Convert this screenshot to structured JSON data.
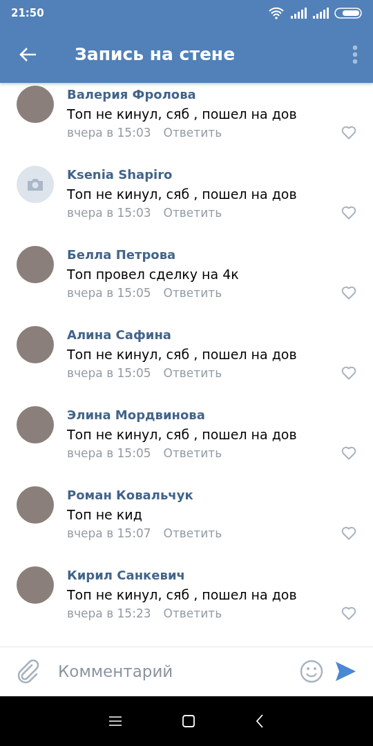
{
  "status_bar": {
    "time": "21:50"
  },
  "toolbar": {
    "title": "Запись на стене"
  },
  "comments": [
    {
      "kind": "photo",
      "author": "Валерия Фролова",
      "text": "Топ не кинул, сяб , пошел на дов",
      "time": "вчера в 15:03",
      "reply": "Ответить"
    },
    {
      "kind": "no_photo",
      "author": "Ksenia Shapiro",
      "text": "Топ не кинул, сяб , пошел на дов",
      "time": "вчера в 15:03",
      "reply": "Ответить"
    },
    {
      "kind": "photo",
      "author": "Белла Петрова",
      "text": "Топ провел сделку на 4к",
      "time": "вчера в 15:05",
      "reply": "Ответить"
    },
    {
      "kind": "photo",
      "author": "Алина Сафина",
      "text": "Топ не кинул, сяб , пошел на дов",
      "time": "вчера в 15:05",
      "reply": "Ответить"
    },
    {
      "kind": "photo",
      "author": "Элина Мордвинова",
      "text": "Топ не кинул, сяб , пошел на дов",
      "time": "вчера в 15:05",
      "reply": "Ответить"
    },
    {
      "kind": "photo",
      "author": "Роман Ковальчук",
      "text": "Топ не кид",
      "time": "вчера в 15:07",
      "reply": "Ответить"
    },
    {
      "kind": "photo",
      "author": "Кирил Санкевич",
      "text": "Топ не кинул, сяб , пошел на дов",
      "time": "вчера в 15:23",
      "reply": "Ответить"
    }
  ],
  "composer": {
    "placeholder": "Комментарий"
  }
}
